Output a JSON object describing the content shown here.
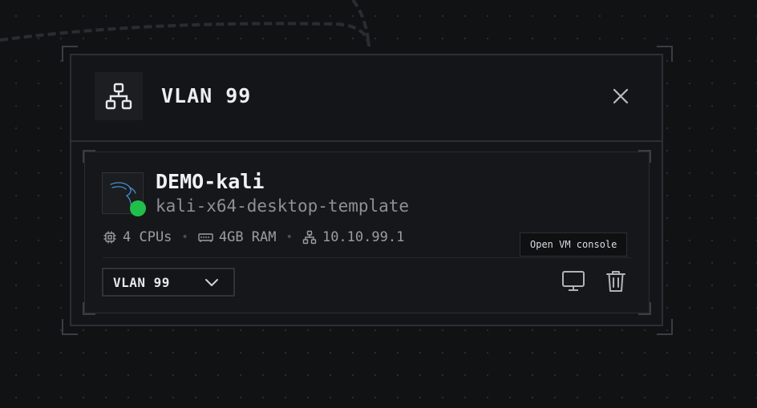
{
  "panel": {
    "title": "VLAN 99",
    "icon": "network-icon",
    "close_icon": "close-icon"
  },
  "vm": {
    "name": "DEMO-kali",
    "template": "kali-x64-desktop-template",
    "avatar_icon": "kali-dragon-icon",
    "status": "running",
    "status_color": "#1fbf4a",
    "specs": {
      "cpus": "4 CPUs",
      "ram": "4GB RAM",
      "ip": "10.10.99.1"
    },
    "network_select": {
      "value": "VLAN 99"
    },
    "tooltip": "Open VM console",
    "actions": [
      {
        "icon": "monitor-icon"
      },
      {
        "icon": "trash-icon"
      }
    ]
  },
  "colors": {
    "background": "#111214",
    "panel": "#141518",
    "border": "#2c2f33",
    "accent_green": "#1fbf4a"
  }
}
